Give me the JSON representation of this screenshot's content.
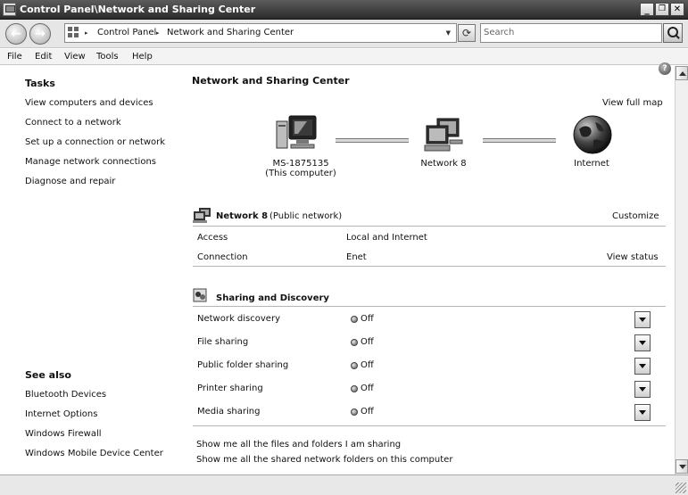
{
  "window": {
    "title": "Control Panel\\Network and Sharing Center",
    "minimize": "_",
    "restore": "❐",
    "close": "✕"
  },
  "address": {
    "crumbs": [
      "Control Panel",
      "Network and Sharing Center"
    ],
    "search_placeholder": "Search"
  },
  "menu": [
    "File",
    "Edit",
    "View",
    "Tools",
    "Help"
  ],
  "sidebar": {
    "tasks_header": "Tasks",
    "tasks": [
      "View computers and devices",
      "Connect to a network",
      "Set up a connection or network",
      "Manage network connections",
      "Diagnose and repair"
    ],
    "see_also_header": "See also",
    "see_also": [
      "Bluetooth Devices",
      "Internet Options",
      "Windows Firewall",
      "Windows Mobile Device Center"
    ]
  },
  "main": {
    "title": "Network and Sharing Center",
    "view_full_map": "View full map",
    "map": {
      "computer_name": "MS-1875135",
      "computer_sub": "(This computer)",
      "network_name": "Network  8",
      "internet": "Internet"
    },
    "network": {
      "name": "Network  8",
      "type": "(Public network)",
      "customize": "Customize",
      "rows": [
        {
          "label": "Access",
          "value": "Local and Internet",
          "action": ""
        },
        {
          "label": "Connection",
          "value": "Enet",
          "action": "View status"
        }
      ]
    },
    "sharing": {
      "title": "Sharing and Discovery",
      "rows": [
        {
          "label": "Network discovery",
          "status": "Off"
        },
        {
          "label": "File sharing",
          "status": "Off"
        },
        {
          "label": "Public folder sharing",
          "status": "Off"
        },
        {
          "label": "Printer sharing",
          "status": "Off"
        },
        {
          "label": "Media sharing",
          "status": "Off"
        }
      ]
    },
    "links": [
      "Show me all the files and folders I am sharing",
      "Show me all the shared network folders on this computer"
    ]
  }
}
